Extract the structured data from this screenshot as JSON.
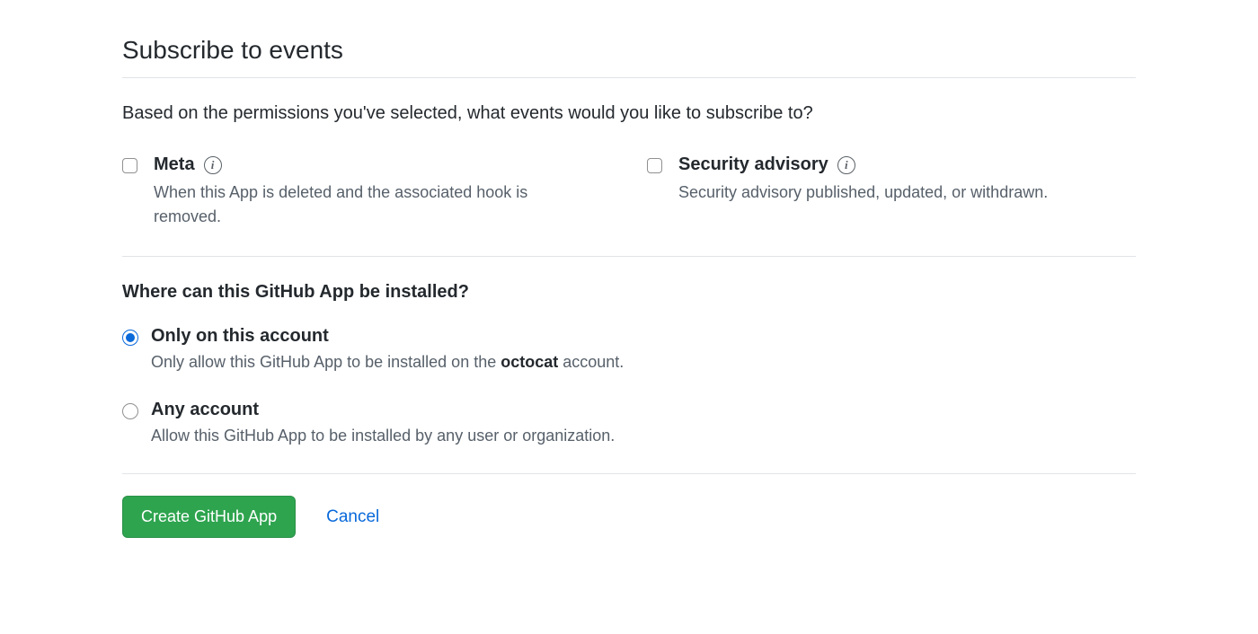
{
  "section": {
    "title": "Subscribe to events",
    "intro": "Based on the permissions you've selected, what events would you like to subscribe to?"
  },
  "events": {
    "meta": {
      "title": "Meta",
      "description": "When this App is deleted and the associated hook is removed.",
      "checked": false
    },
    "security_advisory": {
      "title": "Security advisory",
      "description": "Security advisory published, updated, or withdrawn.",
      "checked": false
    }
  },
  "install_section": {
    "heading": "Where can this GitHub App be installed?",
    "options": {
      "only_this_account": {
        "title": "Only on this account",
        "desc_prefix": "Only allow this GitHub App to be installed on the ",
        "account_name": "octocat",
        "desc_suffix": " account.",
        "selected": true
      },
      "any_account": {
        "title": "Any account",
        "description": "Allow this GitHub App to be installed by any user or organization.",
        "selected": false
      }
    }
  },
  "actions": {
    "create_label": "Create GitHub App",
    "cancel_label": "Cancel"
  },
  "icons": {
    "info_glyph": "i"
  }
}
